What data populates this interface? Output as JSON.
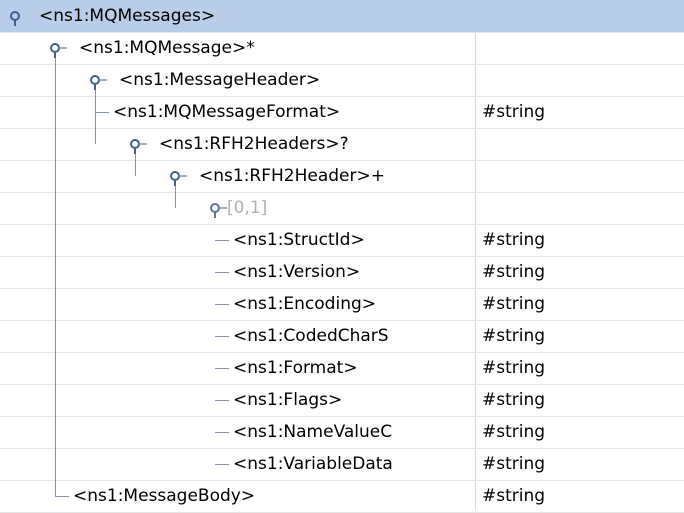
{
  "tree": {
    "rows": [
      {
        "name": "<ns1:MQMessages>",
        "type": "",
        "level": 0,
        "kind": "expanded",
        "selected": true
      },
      {
        "name": "<ns1:MQMessage>*",
        "type": "",
        "level": 1,
        "kind": "expanded"
      },
      {
        "name": "<ns1:MessageHeader>",
        "type": "",
        "level": 2,
        "kind": "expanded"
      },
      {
        "name": "<ns1:MQMessageFormat>",
        "type": "#string",
        "level": 3,
        "kind": "leaf"
      },
      {
        "name": "<ns1:RFH2Headers>?",
        "type": "",
        "level": 3,
        "kind": "expanded"
      },
      {
        "name": "<ns1:RFH2Header>+",
        "type": "",
        "level": 4,
        "kind": "expanded"
      },
      {
        "name": "[0,1]",
        "type": "",
        "level": 5,
        "kind": "group"
      },
      {
        "name": "<ns1:StructId>",
        "type": "#string",
        "level": 6,
        "kind": "leaf"
      },
      {
        "name": "<ns1:Version>",
        "type": "#string",
        "level": 6,
        "kind": "leaf"
      },
      {
        "name": "<ns1:Encoding>",
        "type": "#string",
        "level": 6,
        "kind": "leaf"
      },
      {
        "name": "<ns1:CodedCharS",
        "type": "#string",
        "level": 6,
        "kind": "leaf"
      },
      {
        "name": "<ns1:Format>",
        "type": "#string",
        "level": 6,
        "kind": "leaf"
      },
      {
        "name": "<ns1:Flags>",
        "type": "#string",
        "level": 6,
        "kind": "leaf"
      },
      {
        "name": "<ns1:NameValueC",
        "type": "#string",
        "level": 6,
        "kind": "leaf"
      },
      {
        "name": "<ns1:VariableData",
        "type": "#string",
        "level": 6,
        "kind": "leaf"
      },
      {
        "name": "<ns1:MessageBody>",
        "type": "#string",
        "level": 2,
        "kind": "leaf"
      }
    ]
  },
  "colors": {
    "selection": "#b9cde8",
    "tree_lines": "#7f93ad",
    "group_text": "#b0b0b0"
  }
}
